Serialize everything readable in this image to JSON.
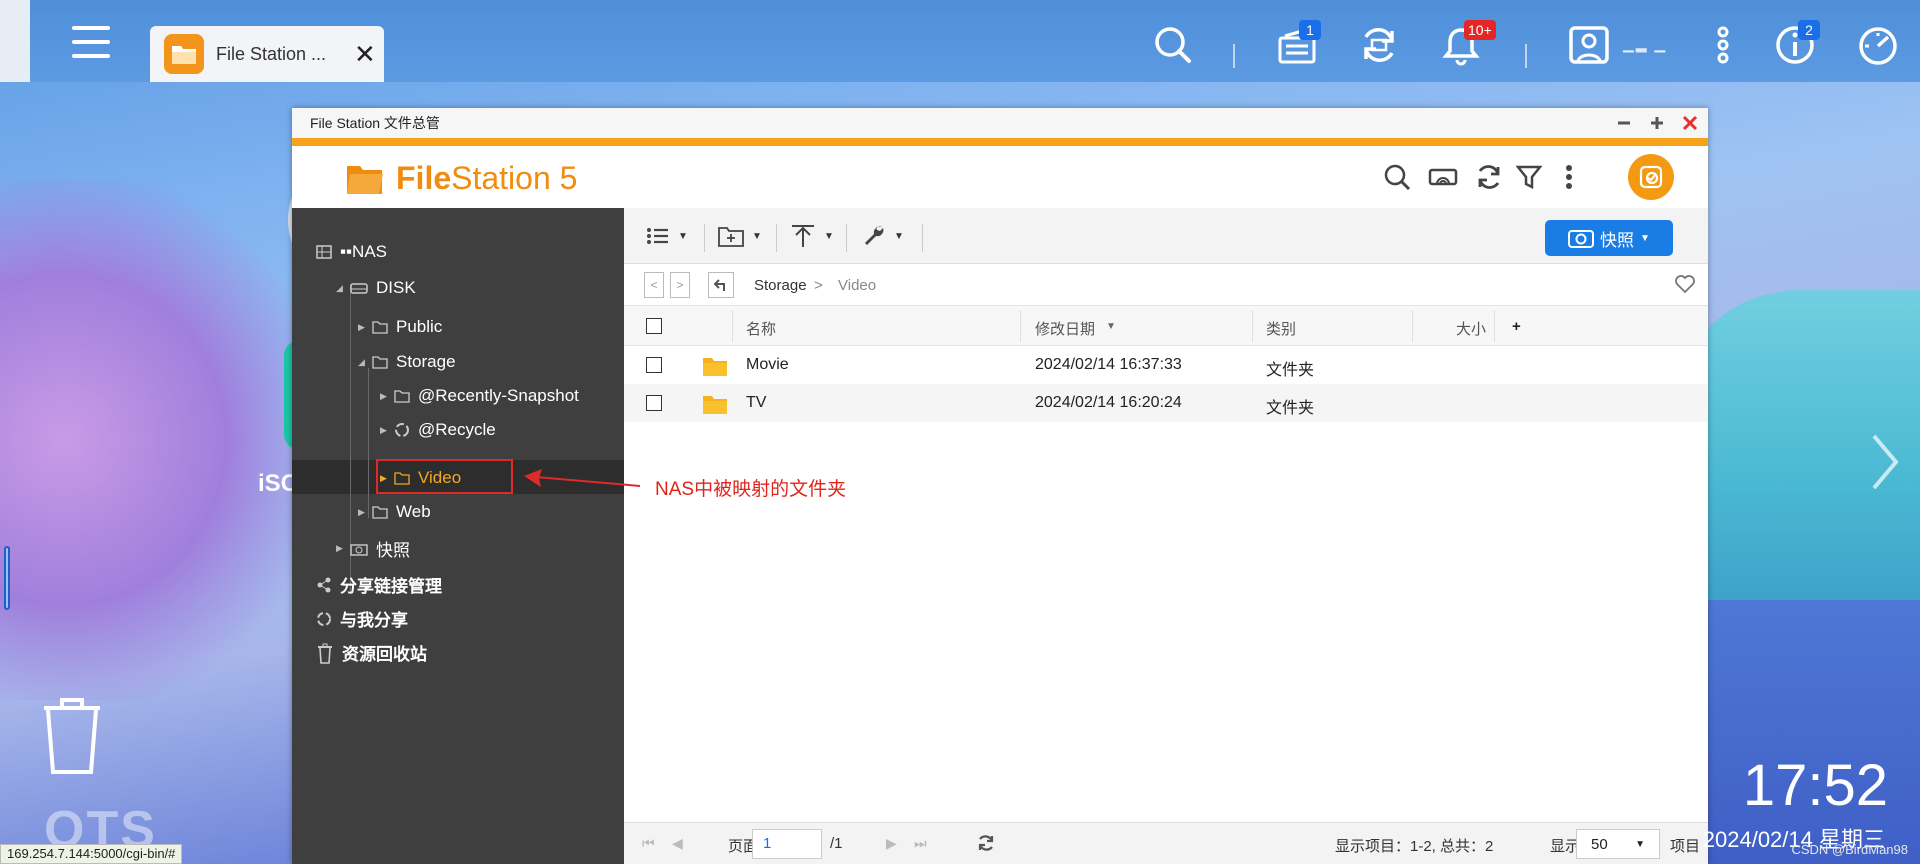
{
  "topbar": {
    "app_tab_label": "File Station ...",
    "close_symbol": "✕",
    "user_name": "▁▂ ▁",
    "badges": {
      "tasks": "1",
      "notifications": "10+",
      "info": "2"
    }
  },
  "window": {
    "title": "File Station 文件总管",
    "logo_bold": "File",
    "logo_rest": "Station 5"
  },
  "sidebar": {
    "root": "▪▪NAS",
    "disk": "DISK",
    "items": [
      {
        "label": "Public"
      },
      {
        "label": "Storage"
      },
      {
        "label": "@Recently-Snapshot"
      },
      {
        "label": "@Recycle"
      },
      {
        "label": "Video"
      },
      {
        "label": "Web"
      },
      {
        "label": "快照"
      }
    ],
    "share_links": "分享链接管理",
    "shared_with_me": "与我分享",
    "recycle_bin": "资源回收站"
  },
  "toolbar": {
    "snapshot_label": "快照"
  },
  "path": {
    "crumbs": [
      "Storage",
      "Video"
    ],
    "separator": ">"
  },
  "table": {
    "columns": {
      "name": "名称",
      "modified": "修改日期",
      "type": "类别",
      "size": "大小",
      "add": "+"
    },
    "rows": [
      {
        "name": "Movie",
        "modified": "2024/02/14 16:37:33",
        "type": "文件夹"
      },
      {
        "name": "TV",
        "modified": "2024/02/14 16:20:24",
        "type": "文件夹"
      }
    ]
  },
  "statusbar": {
    "page_label": "页面",
    "page_value": "1",
    "page_total": "/1",
    "items_info": "显示项目：1-2, 总共：2",
    "show_label": "显示",
    "per_page": "50",
    "items_label": "项目"
  },
  "annotation": {
    "text": "NAS中被映射的文件夹"
  },
  "desktop": {
    "clock": "17:52",
    "date": "2024/02/14 星期三",
    "watermark": "CSDN @BirdMan98",
    "status_url": "169.254.7.144:5000/cgi-bin/#",
    "qts": "QTS",
    "iso": "iSC"
  },
  "colors": {
    "accent_orange": "#f7a21b",
    "selected_text": "#f5a623",
    "snapshot_blue": "#1a7de6",
    "annotation_red": "#e02a2a",
    "sidebar_bg": "#3f3f3f"
  }
}
